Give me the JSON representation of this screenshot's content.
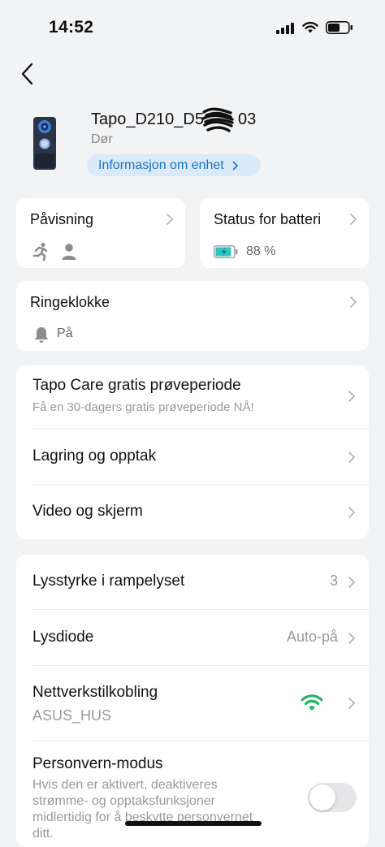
{
  "status_bar": {
    "time": "14:52"
  },
  "device": {
    "name": "Tapo_D210_D5",
    "name_suffix": "03",
    "room": "Dør",
    "info_link": "Informasjon om enhet"
  },
  "detection": {
    "label": "Påvisning"
  },
  "battery": {
    "label": "Status for batteri",
    "value": "88 %",
    "level": 0.88
  },
  "doorbell": {
    "label": "Ringeklokke",
    "state": "På"
  },
  "services": {
    "care_title": "Tapo Care gratis prøveperiode",
    "care_sub": "Få en 30-dagers gratis prøveperiode NÅ!",
    "storage": "Lagring og opptak",
    "video": "Video og skjerm"
  },
  "settings": {
    "spotlight_label": "Lysstyrke i rampelyset",
    "spotlight_value": "3",
    "led_label": "Lysdiode",
    "led_value": "Auto-på",
    "network_label": "Nettverkstilkobling",
    "network_ssid": "ASUS_HUS",
    "privacy_label": "Personvern-modus",
    "privacy_desc_1": "Hvis den er aktivert, deaktiveres",
    "privacy_desc_2": "strømme- og opptaksfunksjoner",
    "privacy_desc_3": "midlertidig for å beskytte personvernet",
    "privacy_desc_4": "ditt.",
    "privacy_enabled": false
  },
  "icons": {
    "back": "back-chevron-icon",
    "motion": "running-person-icon",
    "person": "person-icon",
    "battery": "battery-charging-icon",
    "bell": "bell-icon",
    "wifi": "wifi-icon"
  },
  "colors": {
    "accent": "#1a73c8",
    "wifi_green": "#1fb35a",
    "battery_teal": "#2bc6c6"
  }
}
